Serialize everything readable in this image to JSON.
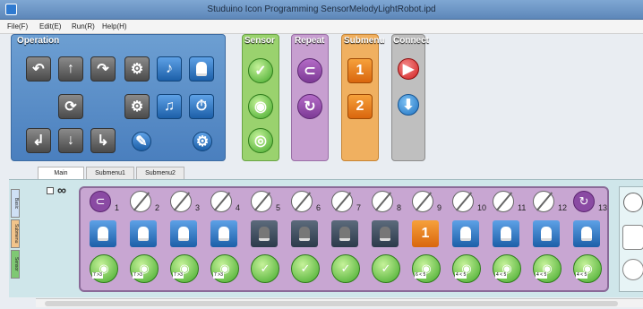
{
  "window": {
    "title": "Studuino Icon Programming  SensorMelodyLightRobot.ipd"
  },
  "menu": [
    "File(F)",
    "Edit(E)",
    "Run(R)",
    "Help(H)"
  ],
  "panels": {
    "operation": "Operation",
    "sensor": "Sensor",
    "repeat": "Repeat",
    "submenu": "Submenu",
    "connect": "Connect"
  },
  "submenu_icons": [
    "1",
    "2"
  ],
  "tabs": [
    "Main",
    "Submenu1",
    "Submenu2"
  ],
  "leftbar": [
    "Basic",
    "Submenu",
    "Repeat",
    "Sensor"
  ],
  "infinity": "∞",
  "program": {
    "columns": [
      {
        "num": "1",
        "top": "repeat-start",
        "mid": "light",
        "bot": "sound-sensor",
        "lbl": "7 >3"
      },
      {
        "num": "2",
        "top": "empty",
        "mid": "light",
        "bot": "sound-sensor",
        "lbl": "7 >3"
      },
      {
        "num": "3",
        "top": "empty",
        "mid": "light",
        "bot": "sound-sensor",
        "lbl": "7 >3"
      },
      {
        "num": "4",
        "top": "empty",
        "mid": "light",
        "bot": "sound-sensor",
        "lbl": "7 >3"
      },
      {
        "num": "5",
        "top": "empty",
        "mid": "light-off",
        "bot": "check",
        "lbl": ""
      },
      {
        "num": "6",
        "top": "empty",
        "mid": "light-off",
        "bot": "check",
        "lbl": ""
      },
      {
        "num": "7",
        "top": "empty",
        "mid": "light-off",
        "bot": "check",
        "lbl": ""
      },
      {
        "num": "8",
        "top": "empty",
        "mid": "light-off",
        "bot": "check",
        "lbl": ""
      },
      {
        "num": "9",
        "top": "empty",
        "mid": "submenu-1",
        "bot": "sound-sensor",
        "lbl": "6 < 5"
      },
      {
        "num": "10",
        "top": "empty",
        "mid": "light",
        "bot": "sound-sensor",
        "lbl": "4 < 5"
      },
      {
        "num": "11",
        "top": "empty",
        "mid": "light",
        "bot": "sound-sensor",
        "lbl": "4 < 5"
      },
      {
        "num": "12",
        "top": "empty",
        "mid": "light",
        "bot": "sound-sensor",
        "lbl": "4 < 5"
      },
      {
        "num": "13",
        "top": "repeat-end",
        "mid": "light",
        "bot": "sound-sensor",
        "lbl": "4 < 5"
      }
    ]
  },
  "colors": {
    "sensor": "#9ad26e",
    "repeat": "#c79fd0",
    "submenu": "#f0b060",
    "connect": "#bfbfbf",
    "operation": "#5a8fc8",
    "program_bg": "#c8a6d2"
  }
}
